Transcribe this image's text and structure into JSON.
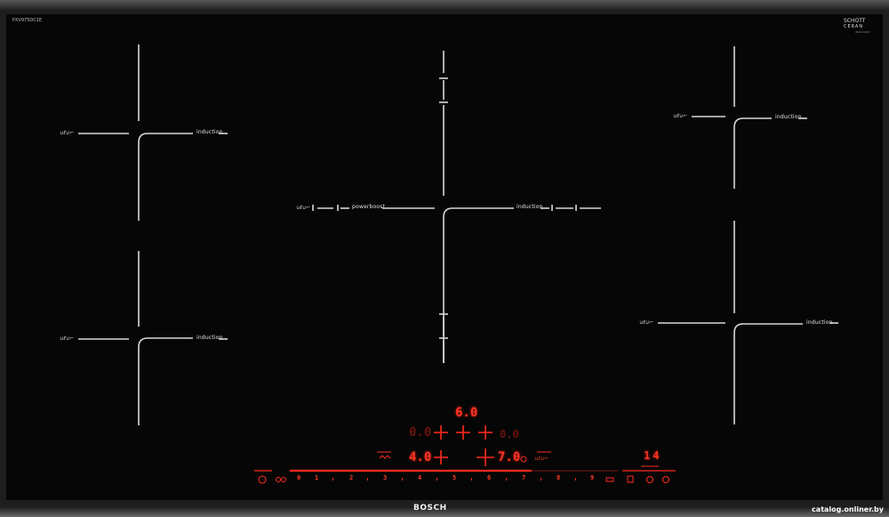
{
  "cooktop": {
    "model_code": "PXV975DC1E",
    "brand": "BOSCH",
    "glass_brand_line1": "SCHOTT",
    "glass_brand_line2": "CERAN",
    "glass_brand_line3": "IN4024000"
  },
  "zones": {
    "left_top_label": "induction",
    "left_bottom_label": "induction",
    "center_label": "induction",
    "center_boost_label": "powerboost",
    "right_top_label": "induction",
    "right_bottom_label": "induction",
    "zone_icon_text": "∪ℓ∪⌐"
  },
  "control_panel": {
    "display_top": "6.0",
    "display_left_dim": "0.0",
    "display_right_dim": "0.0",
    "display_left_active": "4.0",
    "display_right_active": "7.0",
    "timer_display": "14",
    "slider_scale": [
      "0",
      "1",
      "2",
      "3",
      "4",
      "5",
      "6",
      "7",
      "8",
      "9"
    ],
    "accent_red": "#ff2a1f"
  },
  "watermark": "catalog.onliner.by"
}
